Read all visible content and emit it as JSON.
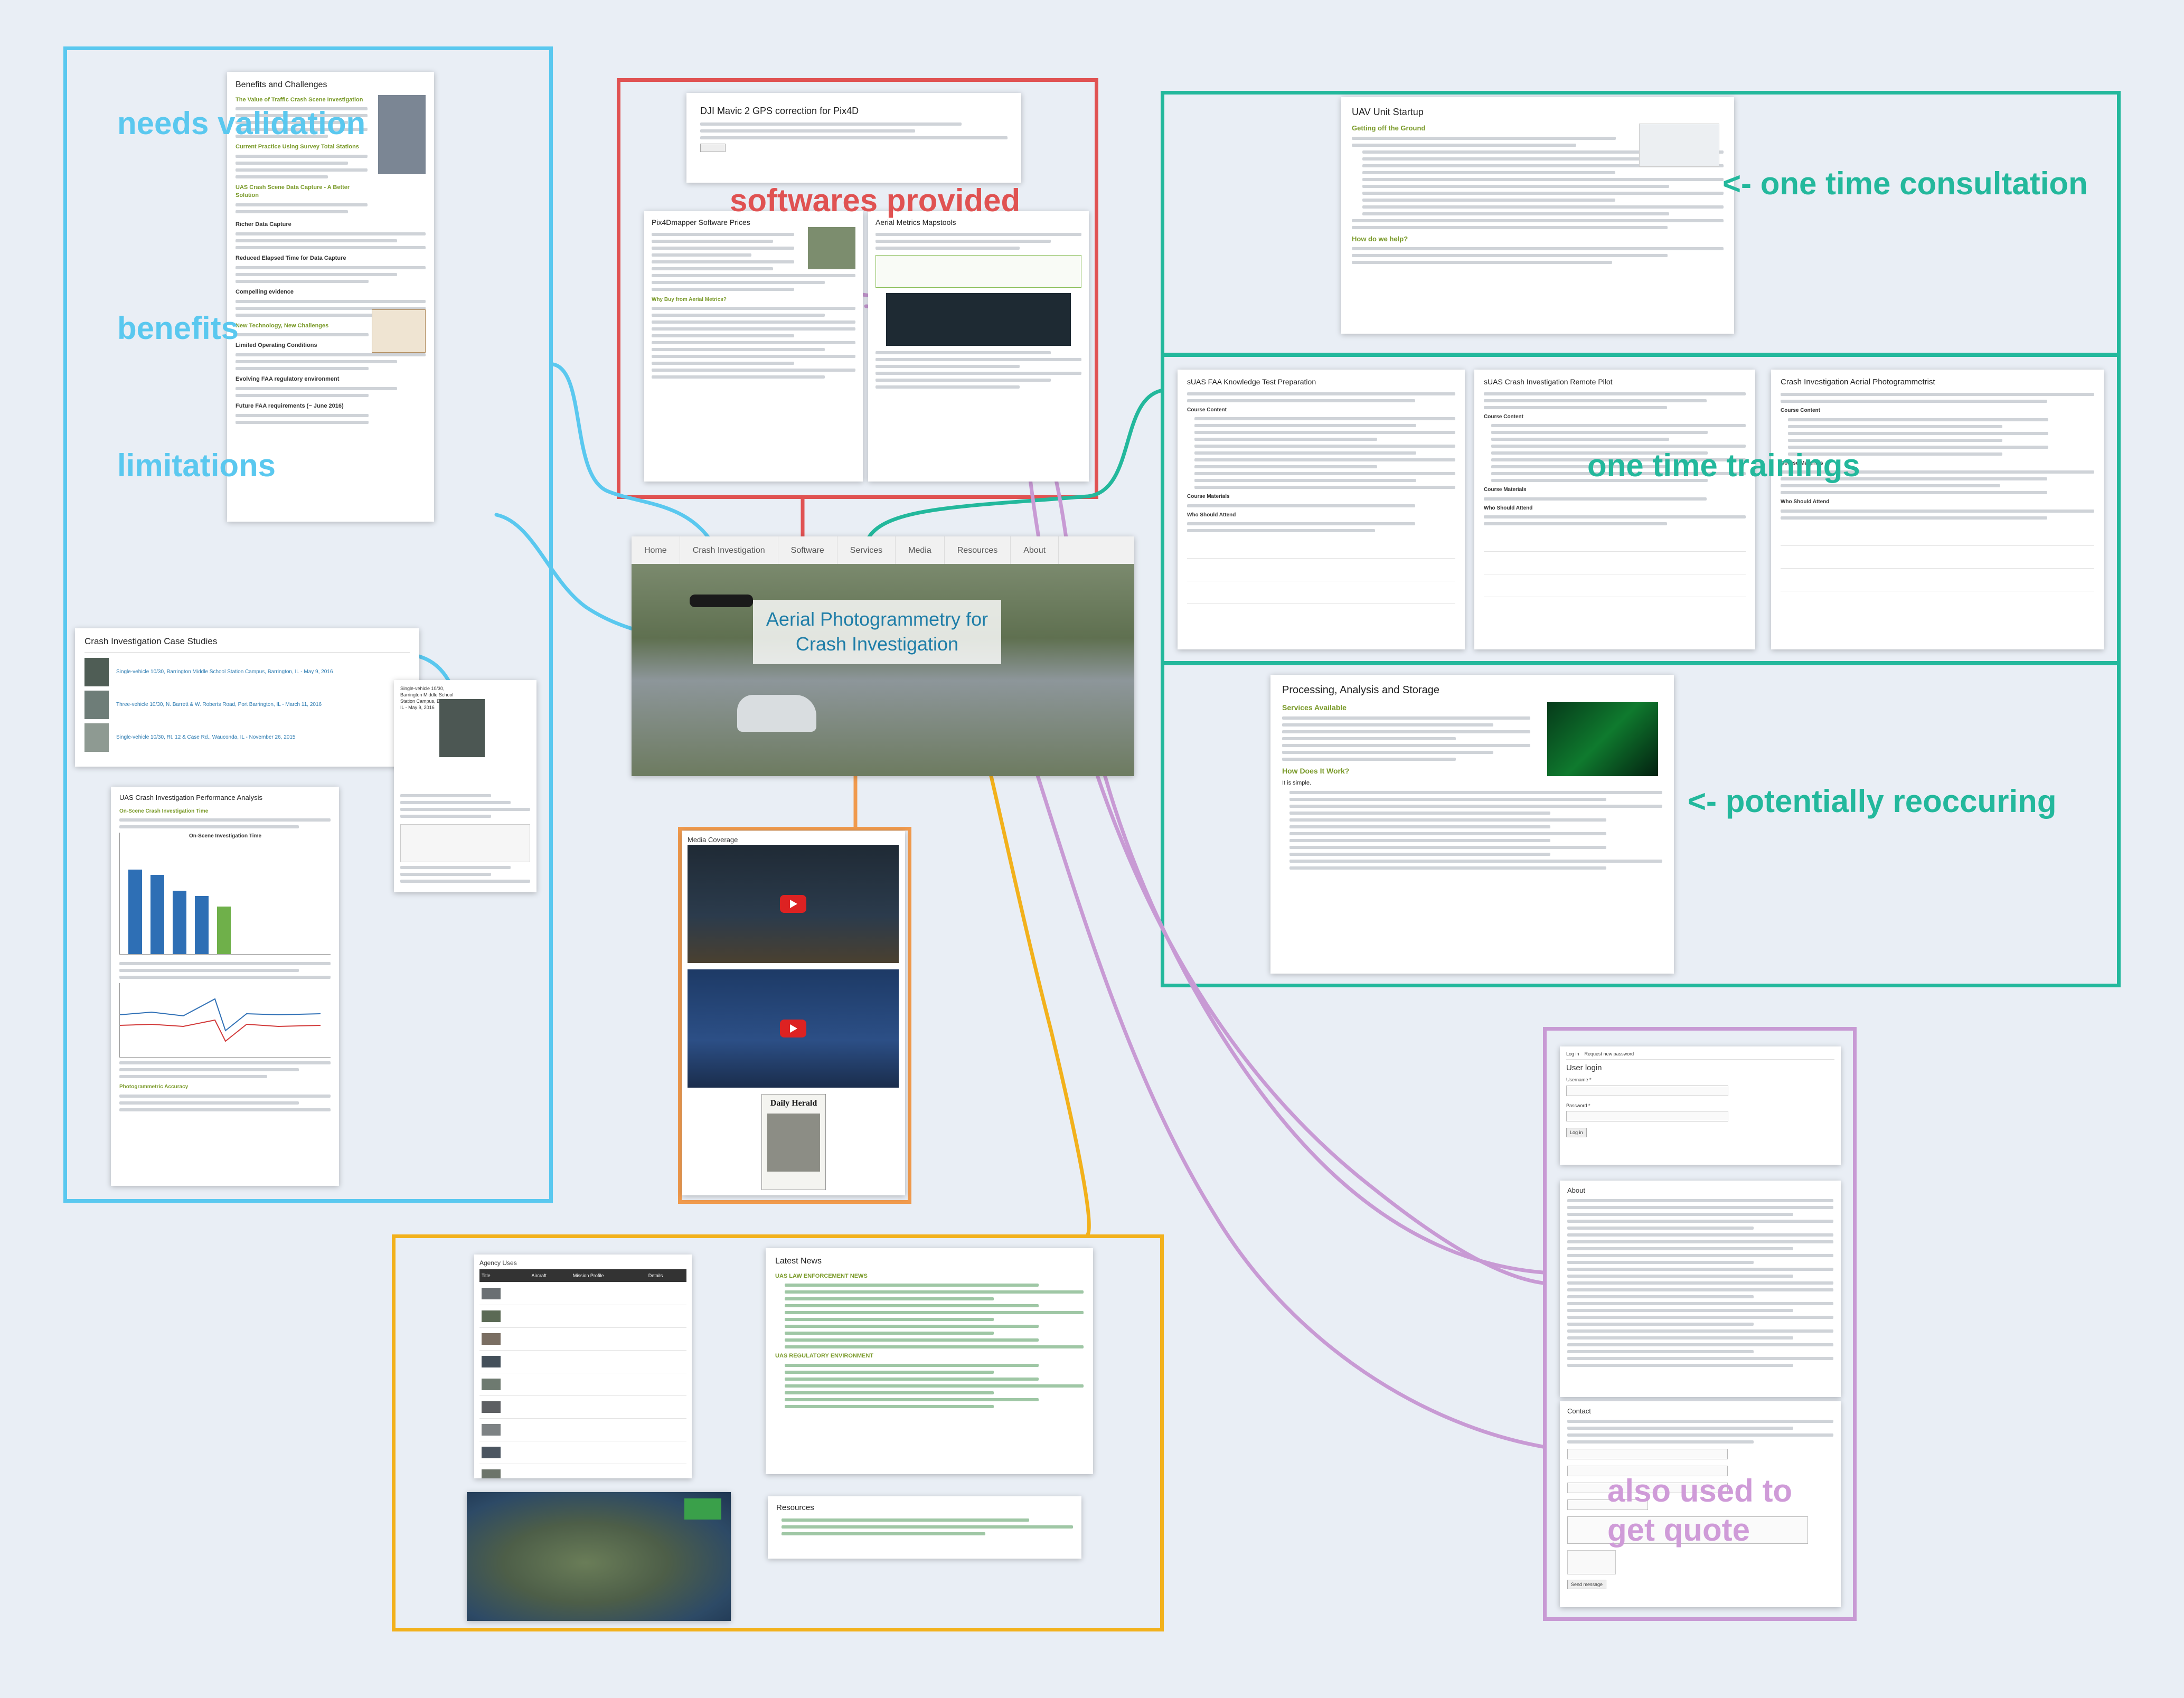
{
  "annotations": {
    "needs_validation": "needs validation",
    "benefits": "benefits",
    "limitations": "limitations",
    "softwares_provided": "softwares  provided",
    "one_time_consultation": "<- one time consultation",
    "one_time_trainings": "one time trainings",
    "potentially_reoccuring": "<- potentially reoccuring",
    "also_used_to": "also used to",
    "get_quote": "get quote"
  },
  "colors": {
    "blue": "#5ac8ef",
    "red": "#e05252",
    "teal": "#23b89c",
    "orange": "#f09a4d",
    "yellow": "#f2b11c",
    "purple": "#c89ad4"
  },
  "home": {
    "nav": [
      "Home",
      "Crash Investigation",
      "Software",
      "Services",
      "Media",
      "Resources",
      "About"
    ],
    "hero_title": "Aerial Photogrammetry for Crash Investigation"
  },
  "benefits_page": {
    "title": "Benefits and Challenges",
    "subs": [
      "The Value of Traffic Crash Scene Investigation",
      "Current Practice Using Survey Total Stations",
      "UAS Crash Scene Data Capture - A Better Solution",
      "New Technology, New Challenges"
    ],
    "sections": [
      "Richer Data Capture",
      "Reduced Elapsed Time for Data Capture",
      "Compelling evidence",
      "Limited Operating Conditions",
      "Evolving FAA regulatory environment",
      "Future FAA requirements (~ June 2016)"
    ]
  },
  "case_studies": {
    "title": "Crash Investigation Case Studies",
    "items": [
      "Single-vehicle 10/30, Barrington Middle School Station Campus, Barrington, IL - May 9, 2016",
      "Three-vehicle 10/30, N. Barrett & W. Roberts Road, Port Barrington, IL - March 11, 2016",
      "Single-vehicle 10/30, Rt. 12 & Case Rd., Wauconda, IL - November 26, 2015"
    ],
    "detail_title": "Single-vehicle 10/30, Barrington Middle School Station Campus, Barrington, IL - May 9, 2016"
  },
  "performance": {
    "title": "UAS Crash Investigation Performance Analysis",
    "sub1": "On-Scene Crash Investigation Time",
    "chart_title": "On-Scene Investigation Time",
    "sub2": "Photogrammetric Accuracy"
  },
  "software": {
    "gps_title": "DJI Mavic 2 GPS correction for Pix4D",
    "prices_title": "Pix4Dmapper Software Prices",
    "why_buy": "Why Buy from Aerial Metrics?",
    "metrics_title": "Aerial Metrics Mapstools"
  },
  "startup": {
    "title": "UAV Unit Startup",
    "sub1": "Getting off the Ground",
    "sub2": "How do we help?"
  },
  "trainings": [
    {
      "title": "sUAS FAA Knowledge Test Preparation",
      "course": "Course Content",
      "materials": "Course Materials",
      "who": "Who Should Attend"
    },
    {
      "title": "sUAS Crash Investigation Remote Pilot",
      "course": "Course Content",
      "materials": "Course Materials",
      "who": "Who Should Attend"
    },
    {
      "title": "Crash Investigation Aerial Photogrammetrist",
      "course": "Course Content",
      "materials": "Course Materials",
      "who": "Who Should Attend"
    }
  ],
  "processing": {
    "title": "Processing, Analysis and Storage",
    "sub1": "Services Available",
    "sub2": "How Does It Work?",
    "intro": "It is simple."
  },
  "media": {
    "title": "Media Coverage",
    "paper": "Daily Herald"
  },
  "agencies": {
    "title": "Agency Uses",
    "headers": [
      "Title",
      "Aircraft",
      "Mission Profile",
      "Details"
    ]
  },
  "news": {
    "title": "Latest News",
    "sub1": "UAS LAW ENFORCEMENT NEWS",
    "sub2": "UAS REGULATORY ENVIRONMENT"
  },
  "resources": {
    "title": "Resources"
  },
  "login": {
    "tabs": [
      "Log in",
      "Request new password"
    ],
    "title": "User login",
    "username": "Username *",
    "password": "Password *",
    "button": "Log in"
  },
  "about": {
    "title": "About"
  },
  "contact": {
    "title": "Contact",
    "send": "Send message"
  }
}
